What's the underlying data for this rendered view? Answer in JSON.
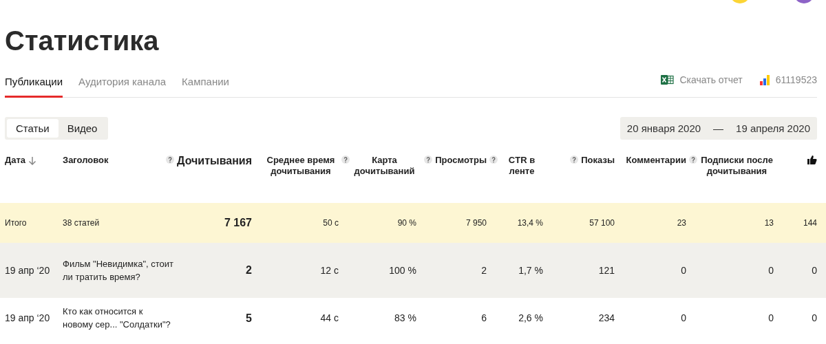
{
  "page": {
    "title": "Статистика"
  },
  "tabs": [
    {
      "label": "Публикации",
      "selected": true
    },
    {
      "label": "Аудитория канала",
      "selected": false
    },
    {
      "label": "Кампании",
      "selected": false
    }
  ],
  "actions": {
    "download": "Скачать отчет",
    "counter": "61119523"
  },
  "content_types": [
    {
      "label": "Статьи",
      "selected": true
    },
    {
      "label": "Видео",
      "selected": false
    }
  ],
  "date_range": {
    "from": "20 января 2020",
    "separator": "—",
    "to": "19 апреля 2020"
  },
  "table": {
    "columns": [
      {
        "kind": "text",
        "label": "Дата",
        "sorted": true,
        "help": false,
        "primary": false
      },
      {
        "kind": "text",
        "label": "Заголовок",
        "sorted": false,
        "help": false,
        "primary": false
      },
      {
        "kind": "text",
        "label": "Дочитывания",
        "sorted": false,
        "help": true,
        "primary": true
      },
      {
        "kind": "text",
        "label": "Среднее время дочитывания",
        "sorted": false,
        "help": false,
        "primary": false
      },
      {
        "kind": "text",
        "label": "Карта дочитываний",
        "sorted": false,
        "help": true,
        "primary": false
      },
      {
        "kind": "text",
        "label": "Просмотры",
        "sorted": false,
        "help": true,
        "primary": false
      },
      {
        "kind": "text",
        "label": "CTR в ленте",
        "sorted": false,
        "help": true,
        "primary": false
      },
      {
        "kind": "text",
        "label": "Показы",
        "sorted": false,
        "help": true,
        "primary": false
      },
      {
        "kind": "text",
        "label": "Комментарии",
        "sorted": false,
        "help": false,
        "primary": false
      },
      {
        "kind": "text",
        "label": "Подписки после дочитывания",
        "sorted": false,
        "help": true,
        "primary": false
      },
      {
        "kind": "likes",
        "sorted": false,
        "help": false,
        "primary": false
      }
    ],
    "rows": [
      {
        "kind": "total",
        "highlighted": false,
        "cells": [
          "Итого",
          "38 статей",
          "7 167",
          "50 с",
          "90 %",
          "7 950",
          "13,4 %",
          "57 100",
          "23",
          "13",
          "144"
        ]
      },
      {
        "kind": "article",
        "highlighted": true,
        "cells": [
          "19 апр ‘20",
          "Фильм \"Невидимка\", стоит ли тратить время?",
          "2",
          "12 с",
          "100 %",
          "2",
          "1,7 %",
          "121",
          "0",
          "0",
          "0"
        ]
      },
      {
        "kind": "article",
        "highlighted": false,
        "cells": [
          "19 апр ‘20",
          "Кто как относится к новому сер... \"Солдатки\"?",
          "5",
          "44 с",
          "83 %",
          "6",
          "2,6 %",
          "234",
          "0",
          "0",
          "0"
        ]
      }
    ]
  }
}
